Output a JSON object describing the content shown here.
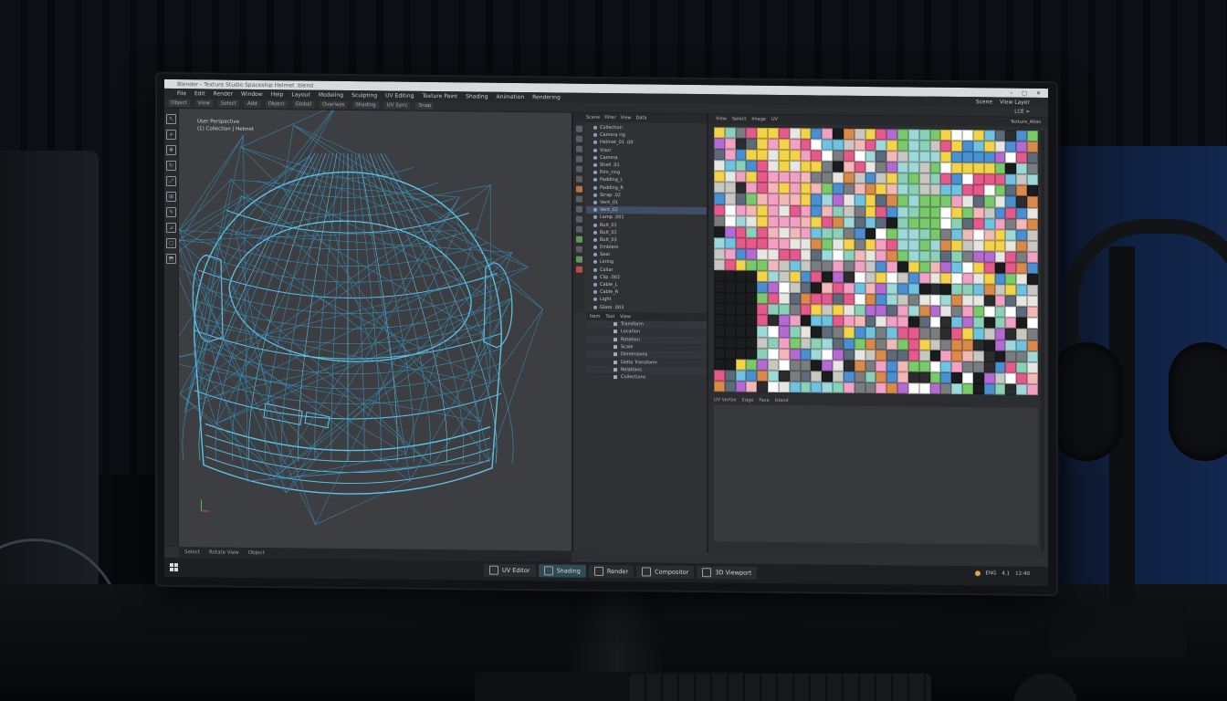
{
  "window": {
    "title": "Blender - Texture Studio Spaceship Helmet .blend",
    "buttons": {
      "minimize": "–",
      "maximize": "□",
      "close": "✕"
    }
  },
  "menu": {
    "items": [
      "File",
      "Edit",
      "Render",
      "Window",
      "Help",
      "Layout",
      "Modeling",
      "Sculpting",
      "UV Editing",
      "Texture Paint",
      "Shading",
      "Animation",
      "Rendering"
    ],
    "right": [
      "Scene",
      "View Layer"
    ]
  },
  "toolbar": {
    "items": [
      "Object",
      "View",
      "Select",
      "Add",
      "Object",
      "Global",
      "Overlays",
      "Shading",
      "UV Sync",
      "Snap"
    ],
    "right": "LCE ∞"
  },
  "viewport": {
    "label_line1": "User Perspective",
    "label_line2": "(1) Collection | Helmet"
  },
  "viewport_status": [
    "Select",
    "Rotate View",
    "Object"
  ],
  "outliner": {
    "tabs": [
      "Scene",
      "Filter",
      "View",
      "Data"
    ],
    "rows": [
      "Collection",
      "Camera rig",
      "Helmet_01 .00",
      "Visor",
      "Camera",
      "Shell .01",
      "Rim_ring",
      "Padding_L",
      "Padding_R",
      "Strap .02",
      "Vent_01",
      "Vent_02",
      "Lamp .001",
      "Bolt_01",
      "Bolt_02",
      "Bolt_03",
      "Emblem",
      "Seal",
      "Lining",
      "Collar",
      "Clip .002",
      "Cable_L",
      "Cable_R",
      "Light",
      "Glass .003"
    ]
  },
  "properties": {
    "tabs": [
      "Item",
      "Tool",
      "View"
    ],
    "rows": [
      "Transform",
      "Location",
      "Rotation",
      "Scale",
      "Dimensions",
      "Delta Transform",
      "Relations",
      "Collections"
    ]
  },
  "uv_editor": {
    "tabs": [
      "View",
      "Select",
      "Image",
      "UV"
    ],
    "right": "Texture_Atlas",
    "status": [
      "UV Vertex",
      "Edge",
      "Face",
      "Island"
    ]
  },
  "bottom": {
    "left_tabs": [
      "Timeline",
      "Dope Sheet",
      "Render Layers"
    ],
    "workspace_tabs": [
      {
        "label": "UV Editor",
        "active": false
      },
      {
        "label": "Shading",
        "active": true
      },
      {
        "label": "Render",
        "active": false
      },
      {
        "label": "Compositor",
        "active": false
      },
      {
        "label": "3D Viewport",
        "active": false
      }
    ],
    "tray": [
      "ENG",
      "4.1",
      "12:40"
    ]
  },
  "colors": {
    "wire": "#5fc3e8",
    "wire_dim": "#3a8fb8",
    "accent_tab": "#2f4a52"
  },
  "icons": {
    "window_logo": "windows-logo-icon",
    "workspace_tab": "editor-type-icon"
  }
}
